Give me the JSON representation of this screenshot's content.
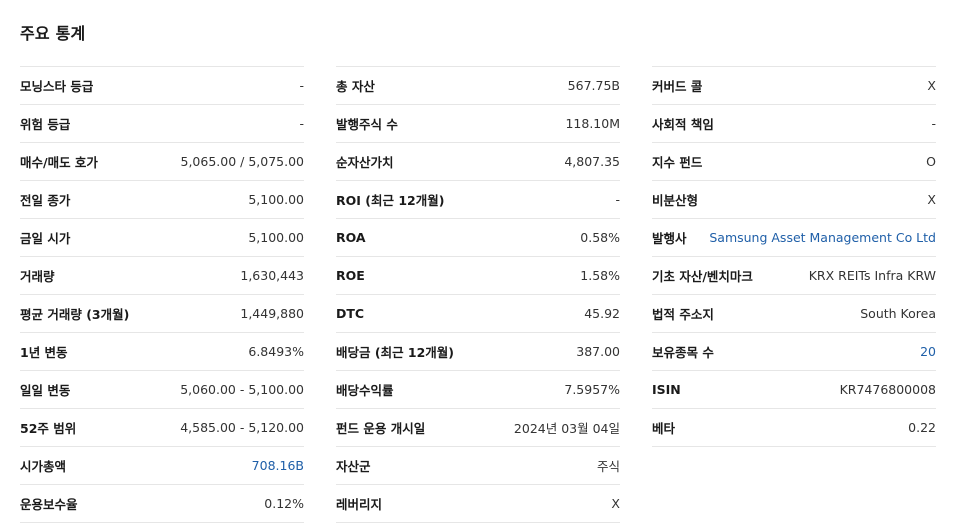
{
  "title": "주요 통계",
  "columns": [
    {
      "rows": [
        {
          "label": "모닝스타 등급",
          "value": "-",
          "link": false
        },
        {
          "label": "위험 등급",
          "value": "-",
          "link": false
        },
        {
          "label": "매수/매도 호가",
          "value": "5,065.00  /  5,075.00",
          "link": false
        },
        {
          "label": "전일 종가",
          "value": "5,100.00",
          "link": false
        },
        {
          "label": "금일 시가",
          "value": "5,100.00",
          "link": false
        },
        {
          "label": "거래량",
          "value": "1,630,443",
          "link": false
        },
        {
          "label": "평균 거래량 (3개월)",
          "value": "1,449,880",
          "link": false
        },
        {
          "label": "1년 변동",
          "value": "6.8493%",
          "link": false
        },
        {
          "label": "일일 변동",
          "value": "5,060.00 - 5,100.00",
          "link": false
        },
        {
          "label": "52주 범위",
          "value": "4,585.00 - 5,120.00",
          "link": false
        },
        {
          "label": "시가총액",
          "value": "708.16B",
          "link": true
        },
        {
          "label": "운용보수율",
          "value": "0.12%",
          "link": false
        }
      ]
    },
    {
      "rows": [
        {
          "label": "총 자산",
          "value": "567.75B",
          "link": false
        },
        {
          "label": "발행주식 수",
          "value": "118.10M",
          "link": false
        },
        {
          "label": "순자산가치",
          "value": "4,807.35",
          "link": false
        },
        {
          "label": "ROI (최근 12개월)",
          "value": "-",
          "link": false
        },
        {
          "label": "ROA",
          "value": "0.58%",
          "link": false
        },
        {
          "label": "ROE",
          "value": "1.58%",
          "link": false
        },
        {
          "label": "DTC",
          "value": "45.92",
          "link": false
        },
        {
          "label": "배당금 (최근 12개월)",
          "value": "387.00",
          "link": false
        },
        {
          "label": "배당수익률",
          "value": "7.5957%",
          "link": false
        },
        {
          "label": "펀드 운용 개시일",
          "value": "2024년 03월 04일",
          "link": false
        },
        {
          "label": "자산군",
          "value": "주식",
          "link": false
        },
        {
          "label": "레버리지",
          "value": "X",
          "link": false
        }
      ]
    },
    {
      "rows": [
        {
          "label": "커버드 콜",
          "value": "X",
          "link": false
        },
        {
          "label": "사회적 책임",
          "value": "-",
          "link": false
        },
        {
          "label": "지수 펀드",
          "value": "O",
          "link": false
        },
        {
          "label": "비분산형",
          "value": "X",
          "link": false
        },
        {
          "label": "발행사",
          "value": "Samsung Asset Management Co Ltd",
          "link": true
        },
        {
          "label": "기초 자산/벤치마크",
          "value": "KRX REITs Infra KRW",
          "link": false
        },
        {
          "label": "법적 주소지",
          "value": "South Korea",
          "link": false
        },
        {
          "label": "보유종목 수",
          "value": "20",
          "link": true
        },
        {
          "label": "ISIN",
          "value": "KR7476800008",
          "link": false
        },
        {
          "label": "베타",
          "value": "0.22",
          "link": false
        }
      ]
    }
  ]
}
